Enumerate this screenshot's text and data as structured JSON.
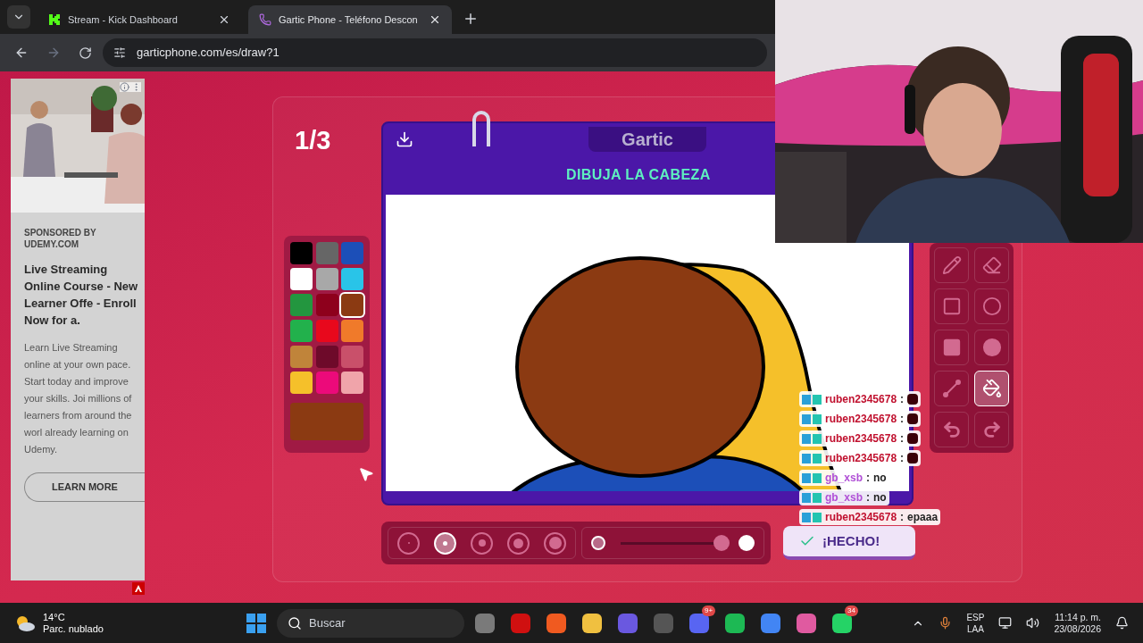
{
  "browser": {
    "tabs": [
      {
        "title": "Stream - Kick Dashboard",
        "selected": false,
        "kind": "kick"
      },
      {
        "title": "Gartic Phone - Teléfono Descon",
        "selected": true,
        "kind": "phone"
      }
    ],
    "url": "garticphone.com/es/draw?1"
  },
  "ad": {
    "sponsor": "SPONSORED BY UDEMY.COM",
    "headline": "Live Streaming Online Course - New Learner Offe - Enroll Now for a.",
    "body": "Learn Live Streaming online at your own pace. Start today and improve your skills. Joi millions of learners from around the worl already learning on Udemy.",
    "button": "LEARN MORE"
  },
  "game": {
    "round": "1/3",
    "logo": "Gartic",
    "prompt": "DIBUJA LA CABEZA",
    "palette": [
      {
        "color": "#000000",
        "selected": false
      },
      {
        "color": "#666666",
        "selected": false
      },
      {
        "color": "#1c4fb8",
        "selected": false
      },
      {
        "color": "#ffffff",
        "selected": false
      },
      {
        "color": "#a8a8a8",
        "selected": false
      },
      {
        "color": "#29c4e8",
        "selected": false
      },
      {
        "color": "#23963f",
        "selected": false
      },
      {
        "color": "#8e001c",
        "selected": false
      },
      {
        "color": "#8b3a12",
        "selected": true
      },
      {
        "color": "#22b14c",
        "selected": false
      },
      {
        "color": "#e8081c",
        "selected": false
      },
      {
        "color": "#f07a2a",
        "selected": false
      },
      {
        "color": "#c0843a",
        "selected": false
      },
      {
        "color": "#6e0a2a",
        "selected": false
      },
      {
        "color": "#c9506a",
        "selected": false
      },
      {
        "color": "#f5c02a",
        "selected": false
      },
      {
        "color": "#ec0a7a",
        "selected": false
      },
      {
        "color": "#f0a4aa",
        "selected": false
      }
    ],
    "brush_sizes": [
      {
        "selected": false
      },
      {
        "selected": true
      },
      {
        "selected": false
      },
      {
        "selected": false
      },
      {
        "selected": false
      }
    ],
    "opacity": {
      "level": 0.98
    },
    "tools": [
      {
        "kind": "pencil",
        "selected": false
      },
      {
        "kind": "eraser",
        "selected": false
      },
      {
        "kind": "square",
        "selected": false
      },
      {
        "kind": "circle",
        "selected": false
      },
      {
        "kind": "filled-square",
        "selected": false
      },
      {
        "kind": "filled-circle",
        "selected": false
      },
      {
        "kind": "line",
        "selected": false
      },
      {
        "kind": "bucket",
        "selected": true
      },
      {
        "kind": "undo",
        "selected": false
      },
      {
        "kind": "redo",
        "selected": false
      }
    ],
    "done_button": "¡HECHO!"
  },
  "chat": [
    {
      "user": "ruben2345678",
      "sep": ":",
      "kind": "emote",
      "color": "#c0102e"
    },
    {
      "user": "ruben2345678",
      "sep": ":",
      "kind": "emote",
      "color": "#c0102e"
    },
    {
      "user": "ruben2345678",
      "sep": ":",
      "kind": "emote",
      "color": "#c0102e"
    },
    {
      "user": "ruben2345678",
      "sep": ":",
      "kind": "emote",
      "color": "#c0102e"
    },
    {
      "user": "gb_xsb",
      "sep": ":",
      "message": "no",
      "kind": "text",
      "color": "#b04fd6"
    },
    {
      "user": "gb_xsb",
      "sep": ":",
      "message": "no",
      "kind": "text",
      "color": "#b04fd6"
    },
    {
      "user": "ruben2345678",
      "sep": ":",
      "message": "epaaa",
      "kind": "text",
      "color": "#c0102e"
    }
  ],
  "taskbar": {
    "temp": "14°C",
    "weather": "Parc. nublado",
    "search": "Buscar",
    "badges": [
      {
        "text": "9+"
      },
      {
        "text": "34"
      }
    ],
    "lang": "ESP",
    "layout": "LAA",
    "time": "11:14 p. m.",
    "date": "23/08/2026"
  }
}
